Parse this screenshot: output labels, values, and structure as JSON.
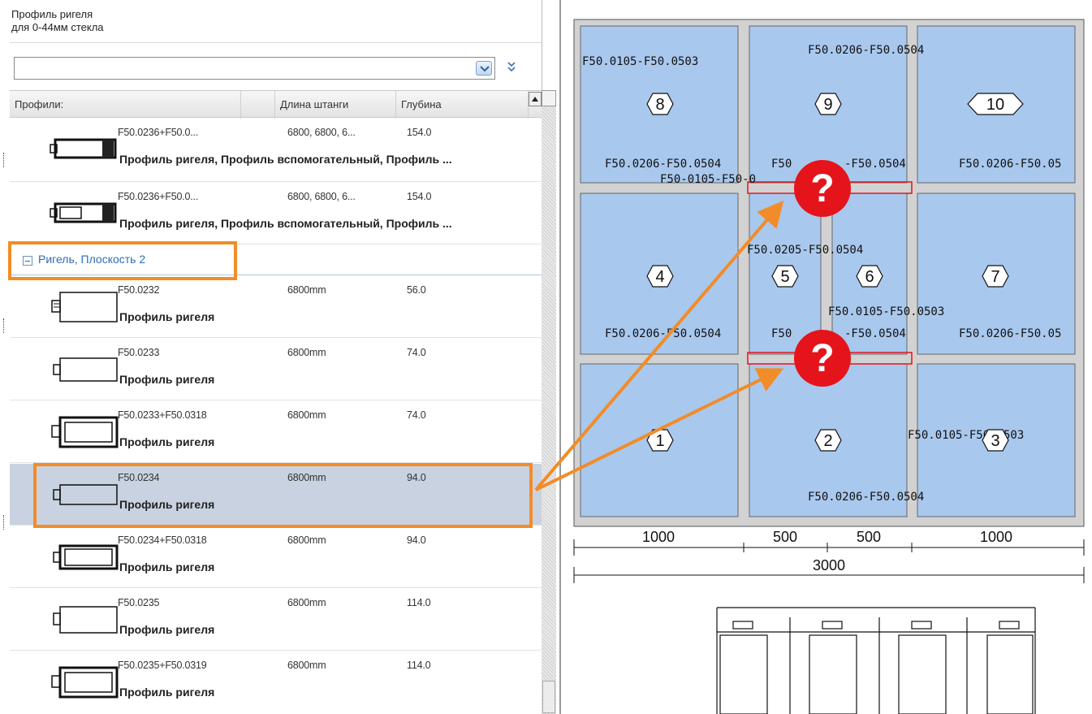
{
  "header": {
    "title_line1": "Профиль ригеля",
    "title_line2": "для 0-44мм стекла"
  },
  "filter": {
    "value": ""
  },
  "grid": {
    "columns": [
      "Профили:",
      "",
      "Длина штанги",
      "Глубина"
    ],
    "rows_top": [
      {
        "code": "F50.0236+F50.0...",
        "length": "6800, 6800, 6...",
        "depth": "154.0",
        "desc": "Профиль ригеля, Профиль вспомогательный, Профиль ..."
      },
      {
        "code": "F50.0236+F50.0...",
        "length": "6800, 6800, 6...",
        "depth": "154.0",
        "desc": "Профиль ригеля, Профиль вспомогательный, Профиль ..."
      }
    ],
    "group_label": "Ригель, Плоскость 2",
    "rows": [
      {
        "code": "F50.0232",
        "length": "6800mm",
        "depth": "56.0",
        "desc": "Профиль ригеля"
      },
      {
        "code": "F50.0233",
        "length": "6800mm",
        "depth": "74.0",
        "desc": "Профиль ригеля"
      },
      {
        "code": "F50.0233+F50.0318",
        "length": "6800mm",
        "depth": "74.0",
        "desc": "Профиль ригеля"
      },
      {
        "code": "F50.0234",
        "length": "6800mm",
        "depth": "94.0",
        "desc": "Профиль ригеля",
        "selected": true
      },
      {
        "code": "F50.0234+F50.0318",
        "length": "6800mm",
        "depth": "94.0",
        "desc": "Профиль ригеля"
      },
      {
        "code": "F50.0235",
        "length": "6800mm",
        "depth": "114.0",
        "desc": "Профиль ригеля"
      },
      {
        "code": "F50.0235+F50.0319",
        "length": "6800mm",
        "depth": "114.0",
        "desc": "Профиль ригеля"
      }
    ]
  },
  "drawing": {
    "labels": {
      "top_left": "F50.0105-F50.0503",
      "top_center": "F50.0206-F50.0504",
      "row2_left": "F50.0206-F50.0504",
      "row2_mid_a": "F50",
      "row2_mid_b": "-F50.0504",
      "row2_right": "F50.0206-F50.05",
      "row2_sub": "F50-0105-F50-0",
      "mid_center": "F50.0205-F50.0504",
      "mid_lower": "F50.0105-F50.0503",
      "row3_left": "F50.0206-F50.0504",
      "row3_mid_a": "F50",
      "row3_mid_b": "-F50.0504",
      "row3_right": "F50.0206-F50.05",
      "bottom_right": "F50.0105-F50.0503",
      "bottom_center": "F50.0206-F50.0504"
    },
    "panels": [
      "1",
      "2",
      "3",
      "4",
      "5",
      "6",
      "7",
      "8",
      "9",
      "10"
    ],
    "dimensions": {
      "d1": "1000",
      "d2": "500",
      "d3": "500",
      "d4": "1000",
      "total": "3000"
    },
    "missing_marker": "?",
    "colors": {
      "glass": "#a9c8ee",
      "frame": "#cfcfcf",
      "highlight": "#f28c28",
      "missing": "#e5141b"
    }
  }
}
